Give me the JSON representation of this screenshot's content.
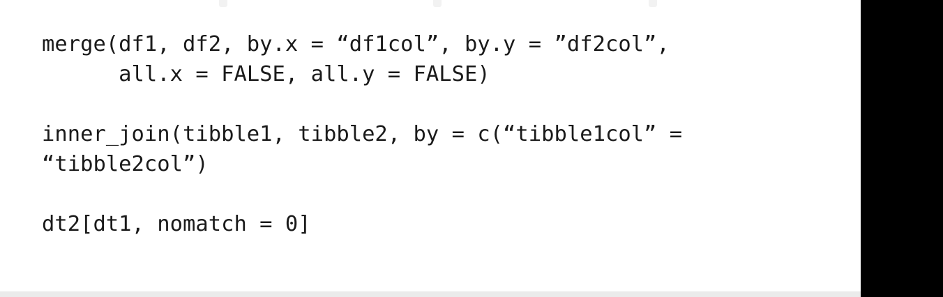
{
  "code": {
    "lines": [
      "merge(df1, df2, by.x = “df1col”, by.y = ”df2col”,",
      "      all.x = FALSE, all.y = FALSE)",
      "",
      "inner_join(tibble1, tibble2, by = c(“tibble1col” =",
      "“tibble2col”)",
      "",
      "dt2[dt1, nomatch = 0]"
    ]
  },
  "colors": {
    "background": "#ffffff",
    "text": "#1a1a1a",
    "side_panel": "#000000"
  }
}
